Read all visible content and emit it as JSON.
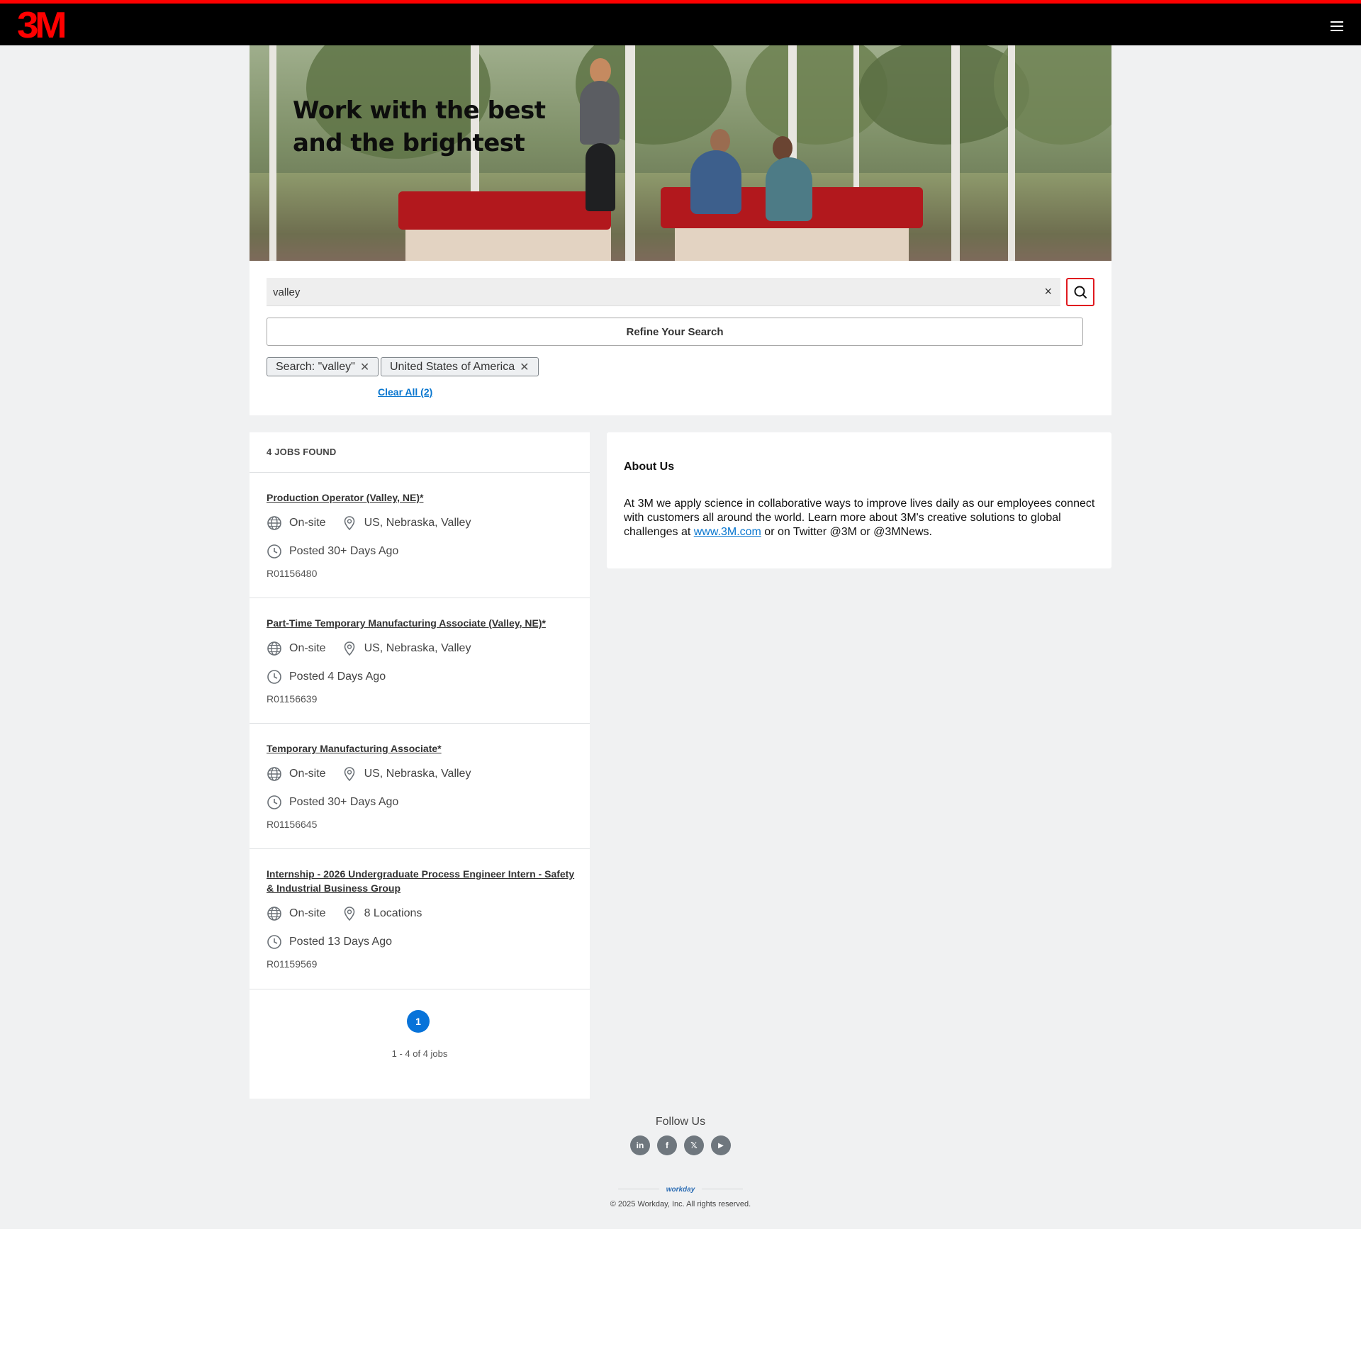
{
  "header": {
    "logo_text": "3M",
    "menu_icon": "hamburger-menu-icon"
  },
  "hero": {
    "title_line1": "Work with the best",
    "title_line2": "and the brightest"
  },
  "search": {
    "value": "valley",
    "clear_symbol": "×",
    "search_icon": "search-icon",
    "refine_label": "Refine Your Search",
    "chips": [
      {
        "label": "Search: \"valley\"",
        "remove_symbol": "✕"
      },
      {
        "label": "United States of America",
        "remove_symbol": "✕"
      }
    ],
    "clear_all_label": "Clear All (2)"
  },
  "jobs": {
    "count_label": "4 JOBS FOUND",
    "items": [
      {
        "title": "Production Operator (Valley, NE)*",
        "work_type": "On-site",
        "location": "US, Nebraska, Valley",
        "posted": "Posted 30+ Days Ago",
        "req_id": "R01156480"
      },
      {
        "title": "Part-Time Temporary Manufacturing Associate (Valley, NE)*",
        "work_type": "On-site",
        "location": "US, Nebraska, Valley",
        "posted": "Posted 4 Days Ago",
        "req_id": "R01156639"
      },
      {
        "title": "Temporary Manufacturing Associate*",
        "work_type": "On-site",
        "location": "US, Nebraska, Valley",
        "posted": "Posted 30+ Days Ago",
        "req_id": "R01156645"
      },
      {
        "title": "Internship - 2026 Undergraduate Process Engineer Intern - Safety & Industrial Business Group",
        "work_type": "On-site",
        "location": "8 Locations",
        "posted": "Posted 13 Days Ago",
        "req_id": "R01159569"
      }
    ],
    "pagination": {
      "current_page": "1",
      "info": "1 - 4 of 4 jobs"
    }
  },
  "about": {
    "title": "About Us",
    "text_before_link": "At 3M we apply science in collaborative ways to improve lives daily as our employees connect with customers all around the world. Learn more about 3M's creative solutions to global challenges at ",
    "link_text": "www.3M.com",
    "text_after_link": " or on Twitter @3M or @3MNews."
  },
  "footer": {
    "follow_label": "Follow Us",
    "social": [
      {
        "icon": "linkedin-icon",
        "glyph": "in"
      },
      {
        "icon": "facebook-icon",
        "glyph": "f"
      },
      {
        "icon": "x-twitter-icon",
        "glyph": "𝕏"
      },
      {
        "icon": "youtube-icon",
        "glyph": "▶"
      }
    ],
    "powered_by": "workday",
    "copyright": "© 2025 Workday, Inc. All rights reserved."
  },
  "colors": {
    "brand_red": "#ff0000",
    "link_blue": "#0876cf",
    "page_button_blue": "#0873d9",
    "background": "#f0f1f2"
  }
}
